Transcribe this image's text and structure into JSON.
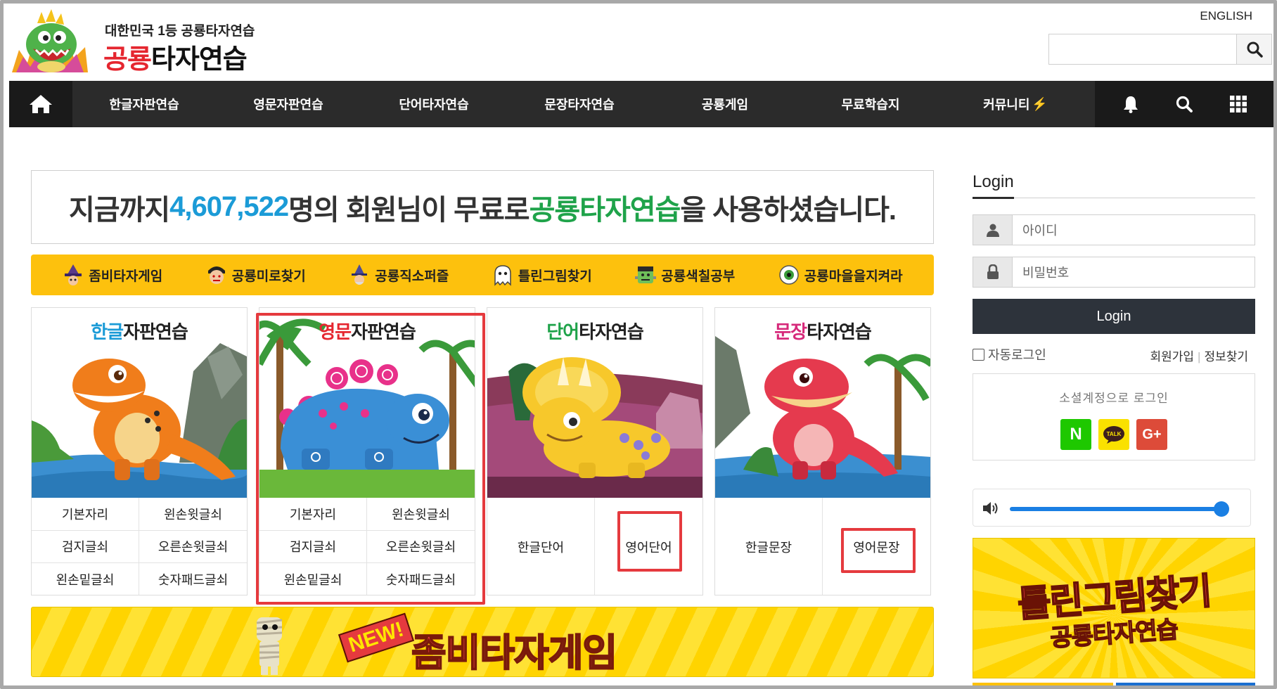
{
  "header": {
    "logo_small": "대한민국 1등 공룡타자연습",
    "logo_red": "공룡",
    "logo_rest": "타자연습",
    "english_link": "ENGLISH"
  },
  "nav": {
    "items": [
      "한글자판연습",
      "영문자판연습",
      "단어타자연습",
      "문장타자연습",
      "공룡게임",
      "무료학습지",
      "커뮤니티"
    ]
  },
  "counter": {
    "prefix": "지금까지 ",
    "count": "4,607,522",
    "middle": "명의 회원님이 무료로 ",
    "brand": "공룡타자연습",
    "suffix": "을 사용하셨습니다."
  },
  "games": [
    "좀비타자게임",
    "공룡미로찾기",
    "공룡직소퍼즐",
    "틀린그림찾기",
    "공룡색칠공부",
    "공룡마을을지켜라"
  ],
  "cards": [
    {
      "title_hl": "한글",
      "title_rest": "자판연습",
      "links": [
        "기본자리",
        "윈손윗글쇠",
        "검지글쇠",
        "오른손윗글쇠",
        "왼손밑글쇠",
        "숫자패드글쇠"
      ]
    },
    {
      "title_hl": "영문",
      "title_rest": "자판연습",
      "links": [
        "기본자리",
        "윈손윗글쇠",
        "검지글쇠",
        "오른손윗글쇠",
        "윈손밑글쇠",
        "숫자패드글쇠"
      ]
    },
    {
      "title_hl": "단어",
      "title_rest": "타자연습",
      "links": [
        "한글단어",
        "영어단어"
      ]
    },
    {
      "title_hl": "문장",
      "title_rest": "타자연습",
      "links": [
        "한글문장",
        "영어문장"
      ]
    }
  ],
  "zombie_banner": {
    "new_label": "NEW!",
    "red": "좀비",
    "rest": "타자게임"
  },
  "login": {
    "heading": "Login",
    "id_placeholder": "아이디",
    "pw_placeholder": "비밀번호",
    "button": "Login",
    "auto_login": "자동로그인",
    "signup": "회원가입",
    "find_info": "정보찾기",
    "social_label": "소셜계정으로 로그인",
    "naver": "N",
    "kakao": "TALK",
    "google": "G+"
  },
  "volume": {
    "level": 0.97,
    "accent": "#1a7fe3"
  },
  "ad_banner": {
    "line1": "틀린그림찾기",
    "line2": "공룡타자연습"
  },
  "colors": {
    "nav_bg": "#2b2b2b",
    "accent_yellow": "#fdc10d",
    "brand_red": "#e5262f",
    "highlight_red": "#e53a3e"
  }
}
